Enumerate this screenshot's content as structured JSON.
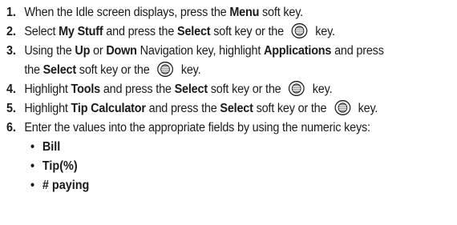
{
  "steps": [
    {
      "num": "1.",
      "parts": [
        "When the Idle screen displays, press the ",
        "Menu",
        " soft key."
      ]
    },
    {
      "num": "2.",
      "parts": [
        "Select ",
        "My Stuff",
        " and press the ",
        "Select",
        " soft key or the ",
        " key."
      ]
    },
    {
      "num": "3.",
      "parts": [
        "Using the ",
        "Up",
        " or ",
        "Down",
        " Navigation key, highlight ",
        "Applications",
        " and press",
        "the ",
        "Select",
        " soft key or the ",
        " key."
      ]
    },
    {
      "num": "4.",
      "parts": [
        "Highlight ",
        "Tools",
        " and press the ",
        "Select",
        " soft key or the ",
        " key."
      ]
    },
    {
      "num": "5.",
      "parts": [
        "Highlight ",
        "Tip Calculator",
        " and press the ",
        "Select",
        " soft key or the ",
        " key."
      ]
    },
    {
      "num": "6.",
      "parts": [
        "Enter the values into the appropriate fields by using the numeric keys:"
      ]
    }
  ],
  "fields": [
    "Bill",
    "Tip(%)",
    "# paying"
  ],
  "bullet_char": "•",
  "icons": {
    "ok_key": "ok-key-icon"
  }
}
